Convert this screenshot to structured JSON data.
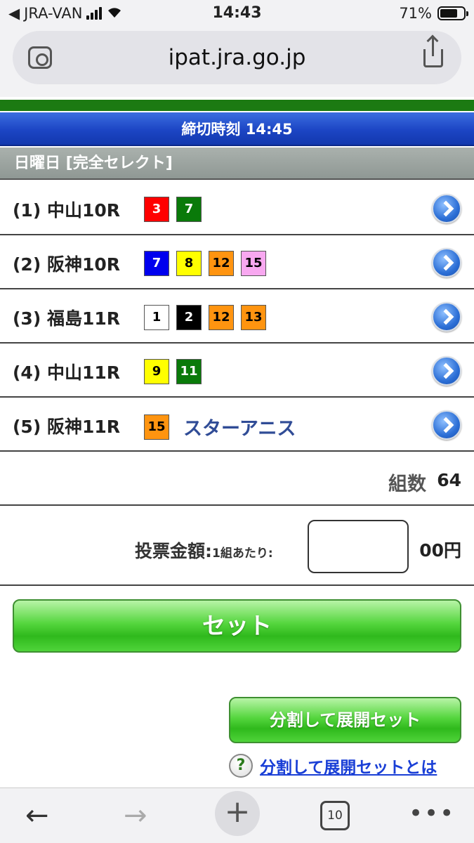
{
  "status": {
    "carrier": "JRA-VAN",
    "time": "14:43",
    "battery": "71%"
  },
  "browser": {
    "url": "ipat.jra.go.jp",
    "tab_count": "10"
  },
  "header": {
    "deadline": "締切時刻 14:45",
    "day_label": "日曜日 [完全セレクト]"
  },
  "races": [
    {
      "label": "(1) 中山10R",
      "horses": [
        {
          "num": "3",
          "bg": "#ff0000",
          "fg": "#ffffff"
        },
        {
          "num": "7",
          "bg": "#0a7a0a",
          "fg": "#ffffff"
        }
      ],
      "name": ""
    },
    {
      "label": "(2) 阪神10R",
      "horses": [
        {
          "num": "7",
          "bg": "#0000ee",
          "fg": "#ffffff"
        },
        {
          "num": "8",
          "bg": "#ffff00",
          "fg": "#000000"
        },
        {
          "num": "12",
          "bg": "#ff9410",
          "fg": "#000000"
        },
        {
          "num": "15",
          "bg": "#f8a8f0",
          "fg": "#000000"
        }
      ],
      "name": ""
    },
    {
      "label": "(3) 福島11R",
      "horses": [
        {
          "num": "1",
          "bg": "#ffffff",
          "fg": "#000000"
        },
        {
          "num": "2",
          "bg": "#000000",
          "fg": "#ffffff"
        },
        {
          "num": "12",
          "bg": "#ff9410",
          "fg": "#000000"
        },
        {
          "num": "13",
          "bg": "#ff9410",
          "fg": "#000000"
        }
      ],
      "name": ""
    },
    {
      "label": "(4) 中山11R",
      "horses": [
        {
          "num": "9",
          "bg": "#ffff00",
          "fg": "#000000"
        },
        {
          "num": "11",
          "bg": "#0a7a0a",
          "fg": "#ffffff"
        }
      ],
      "name": ""
    },
    {
      "label": "(5) 阪神11R",
      "horses": [
        {
          "num": "15",
          "bg": "#ff9410",
          "fg": "#000000"
        }
      ],
      "name": "スターアニス"
    }
  ],
  "summary": {
    "count_label": "組数",
    "count_value": "64"
  },
  "amount": {
    "label": "投票金額:",
    "sub_label": "1組あたり:",
    "value": "",
    "unit": "00円"
  },
  "buttons": {
    "set": "セット",
    "split_set": "分割して展開セット",
    "help_link": "分割して展開セットとは",
    "help_icon": "?"
  },
  "toolbar": {
    "back": "←",
    "forward": "→",
    "new_tab": "+",
    "more": "•••"
  }
}
